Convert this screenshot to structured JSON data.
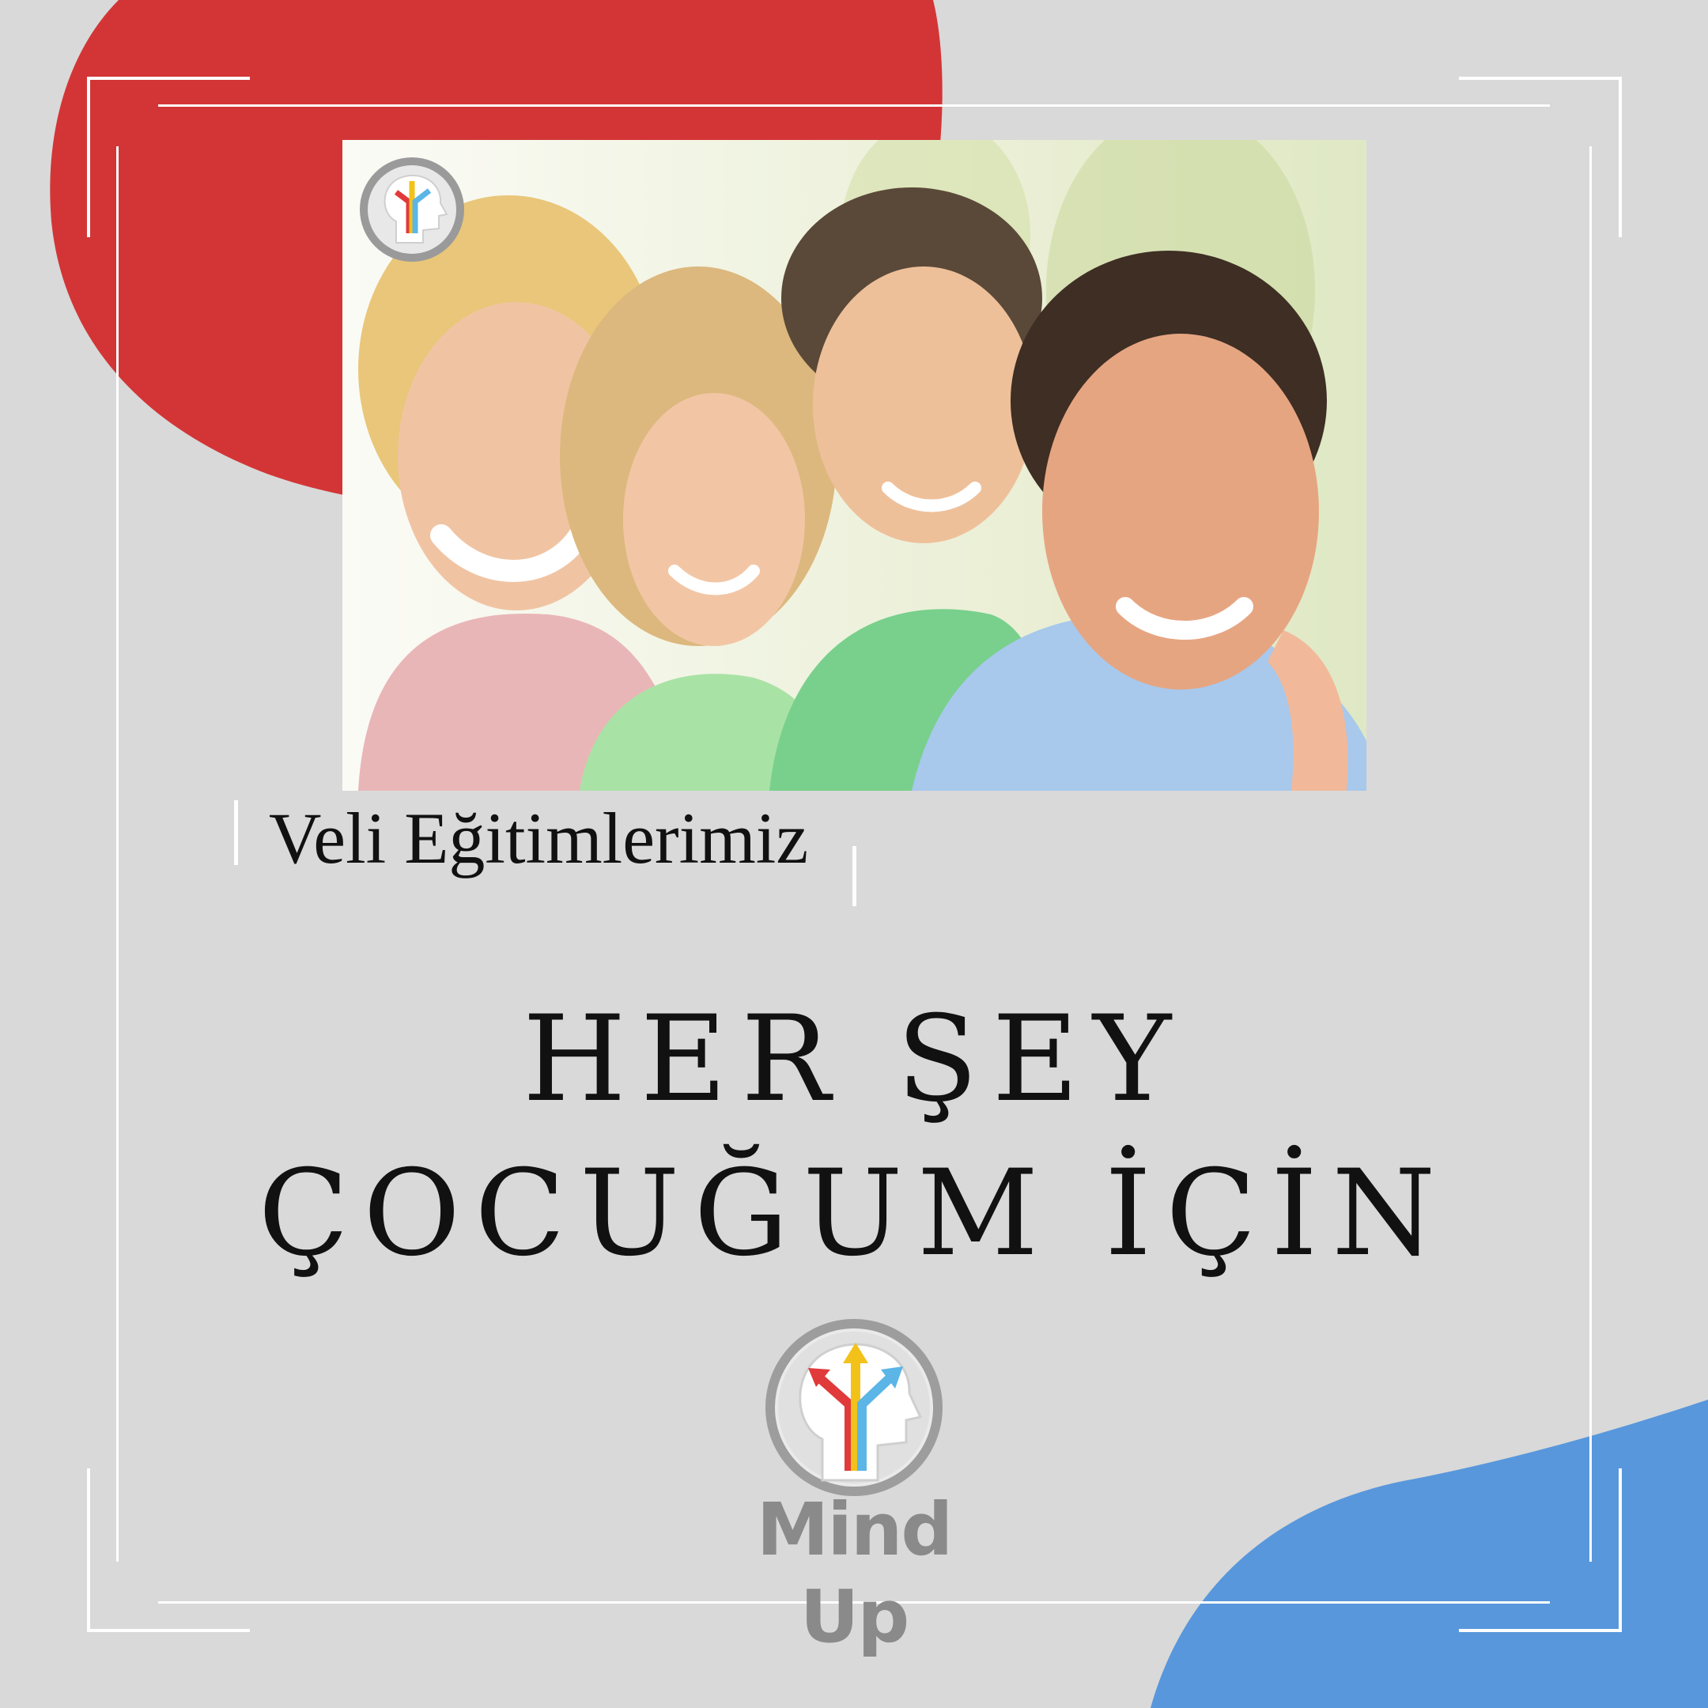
{
  "colors": {
    "background": "#d9d9d9",
    "accent_red": "#d33536",
    "accent_blue": "#5897dc",
    "frame": "#ffffff",
    "text": "#111111",
    "brand_gray": "#8a8a8a"
  },
  "photo": {
    "icon": "family-photo-icon",
    "badge_icon": "mind-up-logo-icon"
  },
  "content": {
    "subtitle": "Veli Eğitimlerimiz",
    "headline_line1": "HER ŞEY",
    "headline_line2": "ÇOCUĞUM İÇİN"
  },
  "brand": {
    "name": "Mind Up",
    "logo_icon": "mind-up-logo-icon"
  }
}
